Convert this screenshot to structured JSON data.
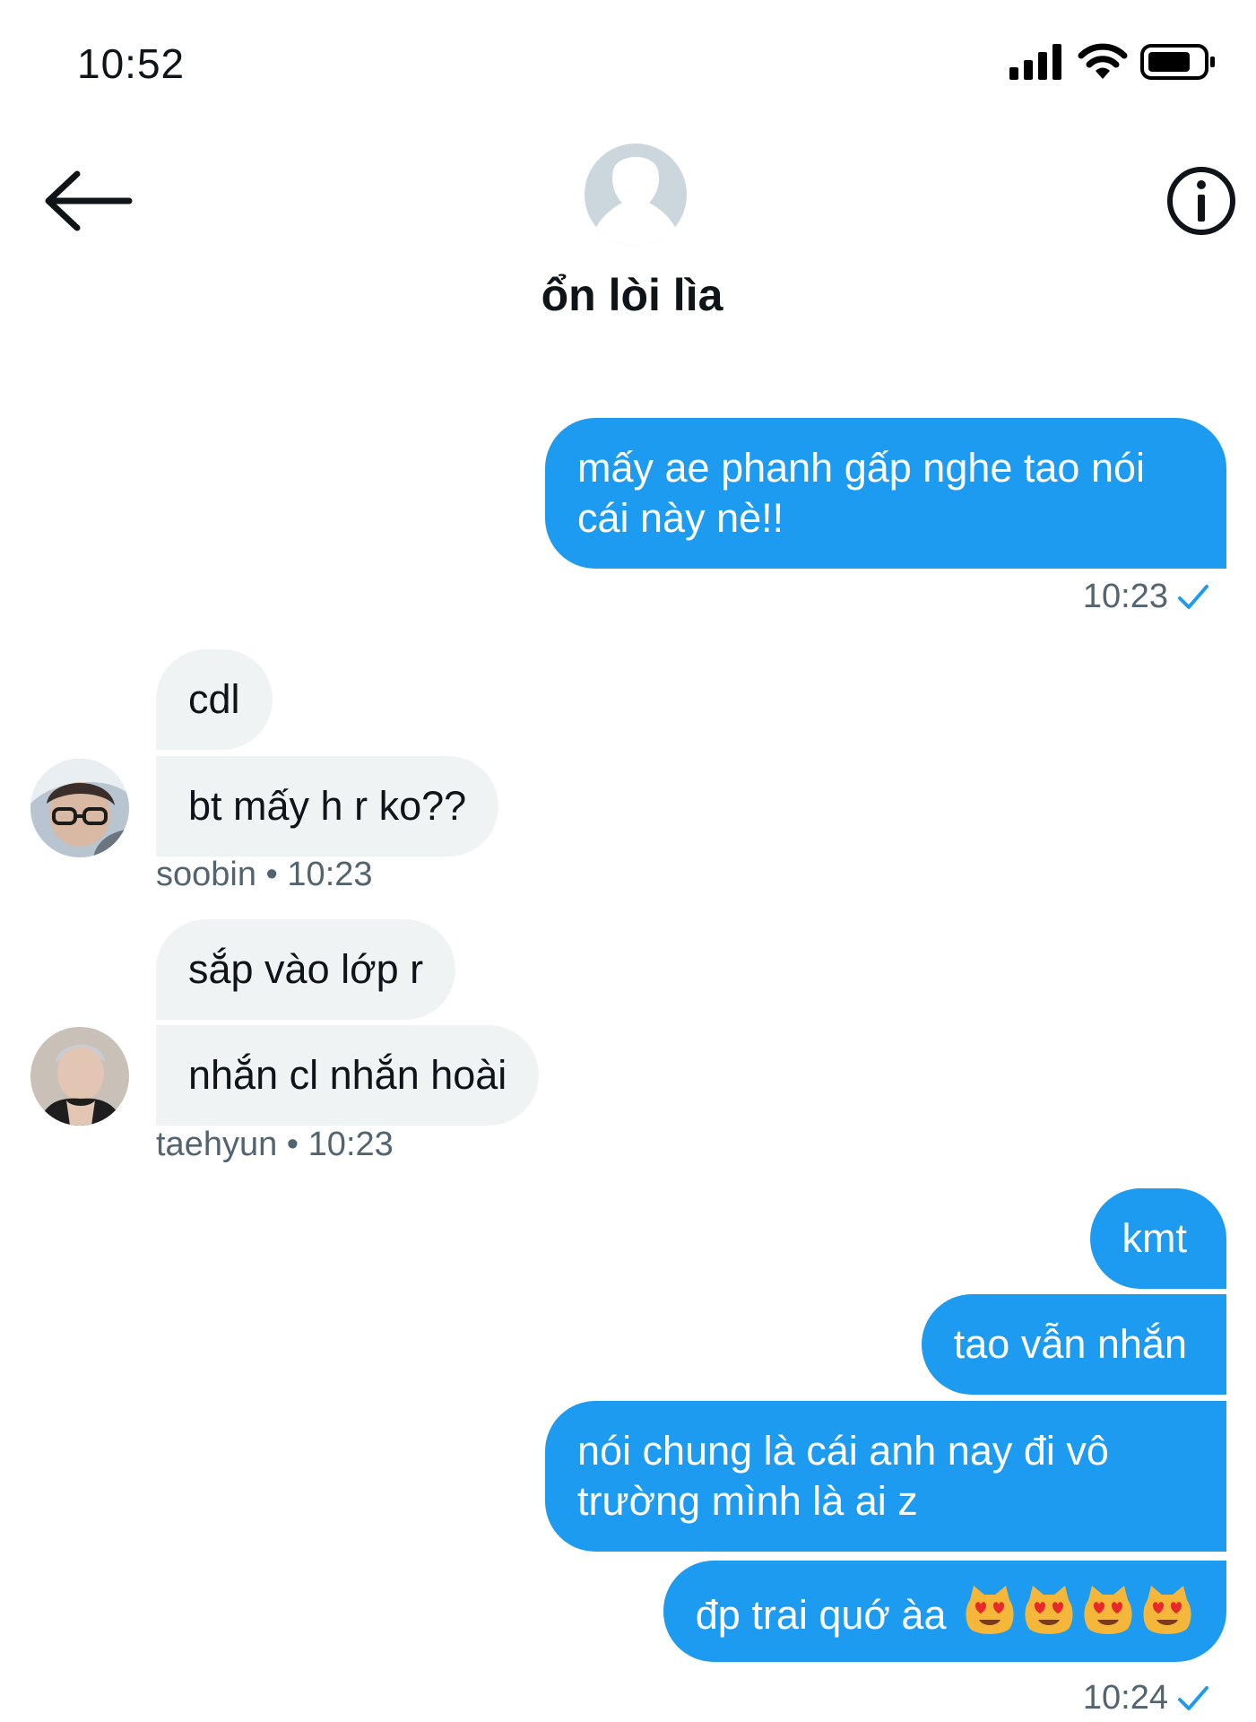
{
  "status_bar": {
    "time": "10:52"
  },
  "header": {
    "name": "ổn lòi lìa"
  },
  "messages": {
    "m1": {
      "text": "mấy ae phanh gấp nghe tao nói cái này nè!!",
      "time": "10:23"
    },
    "m2": {
      "text": "cdl"
    },
    "m3": {
      "text": "bt mấy h r ko??"
    },
    "m3_meta": {
      "sender": "soobin",
      "sep": "•",
      "time": "10:23"
    },
    "m4": {
      "text": "sắp vào lớp r"
    },
    "m5": {
      "text": "nhắn cl nhắn hoài"
    },
    "m5_meta": {
      "sender": "taehyun",
      "sep": "•",
      "time": "10:23"
    },
    "m6": {
      "text": "kmt"
    },
    "m7": {
      "text": "tao vẫn nhắn"
    },
    "m8": {
      "text": "nói chung là cái anh nay đi vô trường mình là ai z"
    },
    "m9": {
      "text": "đp trai quớ àa",
      "time": "10:24"
    }
  },
  "colors": {
    "accent": "#1d9bf0",
    "incoming_bg": "#eff3f4",
    "meta": "#536471"
  },
  "icons": [
    "back-arrow-icon",
    "info-icon",
    "signal-icon",
    "wifi-icon",
    "battery-icon",
    "read-check-icon",
    "heart-eyes-cat-icon"
  ]
}
